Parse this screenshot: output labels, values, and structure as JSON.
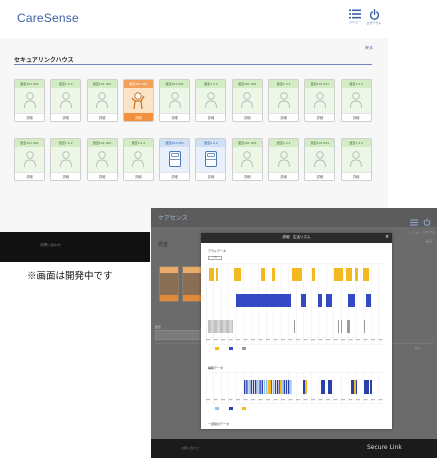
{
  "header": {
    "brand": "CareSense",
    "menu_label": "メニュー",
    "logout_label": "ログアウト",
    "back_label": "戻る"
  },
  "facility": {
    "name": "セキュアリンクハウス"
  },
  "rooms": {
    "row1": [
      {
        "tag": "居室101 001",
        "status": "normal",
        "footer": "詳細"
      },
      {
        "tag": "居室1 0 2",
        "status": "normal",
        "footer": "詳細"
      },
      {
        "tag": "居室101 001",
        "status": "normal",
        "footer": "詳細"
      },
      {
        "tag": "居室101 001",
        "status": "alert",
        "footer": "詳細"
      },
      {
        "tag": "居室101 001",
        "status": "normal",
        "footer": "詳細"
      },
      {
        "tag": "居室1 0 2",
        "status": "normal",
        "footer": "詳細"
      },
      {
        "tag": "居室101 001",
        "status": "normal",
        "footer": "詳細"
      },
      {
        "tag": "居室1 0 2",
        "status": "normal",
        "footer": "詳細"
      },
      {
        "tag": "居室101 001",
        "status": "normal",
        "footer": "詳細"
      },
      {
        "tag": "居室1 0 2",
        "status": "normal",
        "footer": "詳細"
      }
    ],
    "row2": [
      {
        "tag": "居室101 001",
        "status": "normal",
        "footer": "詳細"
      },
      {
        "tag": "居室1 0 2",
        "status": "normal",
        "footer": "詳細"
      },
      {
        "tag": "居室101 001",
        "status": "normal",
        "footer": "詳細"
      },
      {
        "tag": "居室1 0 2",
        "status": "normal",
        "footer": "詳細"
      },
      {
        "tag": "居室101 001",
        "status": "bed",
        "footer": "詳細"
      },
      {
        "tag": "居室1 0 2",
        "status": "bed",
        "footer": "詳細"
      },
      {
        "tag": "居室101 001",
        "status": "normal",
        "footer": "詳細"
      },
      {
        "tag": "居室1 0 2",
        "status": "normal",
        "footer": "詳細"
      },
      {
        "tag": "居室101 001",
        "status": "normal",
        "footer": "詳細"
      },
      {
        "tag": "居室1 0 2",
        "status": "normal",
        "footer": "詳細"
      }
    ]
  },
  "footer": {
    "copyright": "お問い合わせ"
  },
  "notice": "※画面は開発中です",
  "overlay": {
    "brand": "ケアセンス",
    "title": "居室",
    "footer_left": "お問い合わせ",
    "footer_right": "Secure Link"
  },
  "modal": {
    "title": "詳細　生活リズム",
    "close": "×",
    "section1_title": "アラルデータ",
    "section2_title": "睡眠データ",
    "section3_title": "一週間のデータ",
    "chip_label": "凡例"
  },
  "colors": {
    "accent": "#3a5fa8",
    "normal_tile": "#d3ecc5",
    "alert_tile": "#f2903d",
    "bed_tile": "#cfe0f5",
    "activity_yellow": "#f5b81f",
    "activity_blue": "#3549c4",
    "activity_gray": "#9a9a9a",
    "sleep_light": "#8fc2ef",
    "sleep_dark": "#2a40a8"
  },
  "icons": {
    "menu": "menu-list-icon",
    "logout": "power-icon",
    "resident": "person-icon",
    "resident_alert": "person-waving-icon",
    "bed": "bed-icon"
  }
}
